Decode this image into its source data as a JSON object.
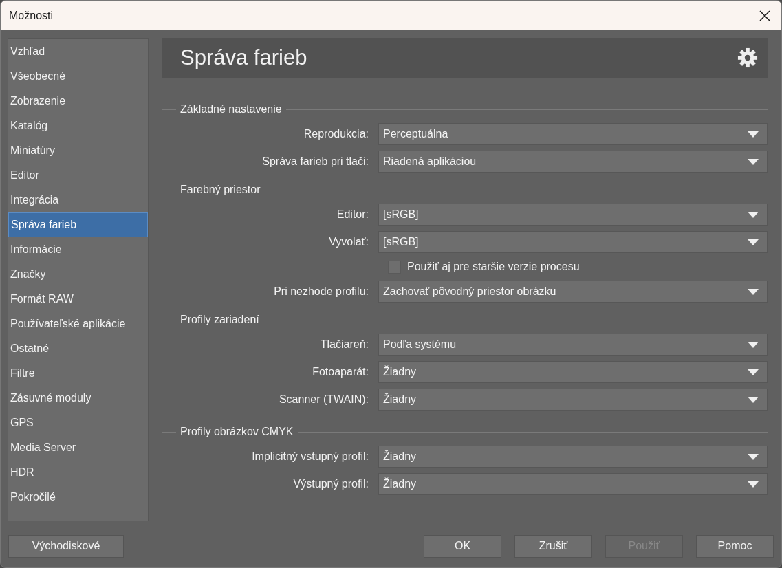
{
  "window": {
    "title": "Možnosti"
  },
  "sidebar": {
    "items": [
      {
        "label": "Vzhľad",
        "selected": false
      },
      {
        "label": "Všeobecné",
        "selected": false
      },
      {
        "label": "Zobrazenie",
        "selected": false
      },
      {
        "label": "Katalóg",
        "selected": false
      },
      {
        "label": "Miniatúry",
        "selected": false
      },
      {
        "label": "Editor",
        "selected": false
      },
      {
        "label": "Integrácia",
        "selected": false
      },
      {
        "label": "Správa farieb",
        "selected": true
      },
      {
        "label": "Informácie",
        "selected": false
      },
      {
        "label": "Značky",
        "selected": false
      },
      {
        "label": "Formát RAW",
        "selected": false
      },
      {
        "label": "Používateľské aplikácie",
        "selected": false
      },
      {
        "label": "Ostatné",
        "selected": false
      },
      {
        "label": "Filtre",
        "selected": false
      },
      {
        "label": "Zásuvné moduly",
        "selected": false
      },
      {
        "label": "GPS",
        "selected": false
      },
      {
        "label": "Media Server",
        "selected": false
      },
      {
        "label": "HDR",
        "selected": false
      },
      {
        "label": "Pokročilé",
        "selected": false
      }
    ]
  },
  "page": {
    "title": "Správa farieb"
  },
  "sections": [
    {
      "title": "Základné nastavenie",
      "rows": [
        {
          "kind": "select",
          "label": "Reprodukcia:",
          "value": "Perceptuálna"
        },
        {
          "kind": "select",
          "label": "Správa farieb pri tlači:",
          "value": "Riadená aplikáciou"
        }
      ]
    },
    {
      "title": "Farebný priestor",
      "rows": [
        {
          "kind": "select",
          "label": "Editor:",
          "value": "[sRGB]"
        },
        {
          "kind": "select",
          "label": "Vyvolať:",
          "value": "[sRGB]"
        },
        {
          "kind": "checkbox",
          "label": "Použiť aj pre staršie verzie procesu",
          "checked": false
        },
        {
          "kind": "select",
          "label": "Pri nezhode profilu:",
          "value": "Zachovať pôvodný priestor obrázku"
        }
      ]
    },
    {
      "title": "Profily zariadení",
      "rows": [
        {
          "kind": "select",
          "label": "Tlačiareň:",
          "value": "Podľa systému"
        },
        {
          "kind": "select",
          "label": "Fotoaparát:",
          "value": "Žiadny"
        },
        {
          "kind": "select",
          "label": "Scanner (TWAIN):",
          "value": "Žiadny"
        }
      ]
    },
    {
      "title": "Profily obrázkov CMYK",
      "rows": [
        {
          "kind": "select",
          "label": "Implicitný vstupný profil:",
          "value": "Žiadny"
        },
        {
          "kind": "select",
          "label": "Výstupný profil:",
          "value": "Žiadny"
        }
      ]
    }
  ],
  "footer": {
    "left_button": {
      "label": "Východiskové",
      "disabled": false
    },
    "buttons": [
      {
        "label": "OK",
        "disabled": false
      },
      {
        "label": "Zrušiť",
        "disabled": false
      },
      {
        "label": "Použiť",
        "disabled": true
      },
      {
        "label": "Pomoc",
        "disabled": false
      }
    ]
  }
}
